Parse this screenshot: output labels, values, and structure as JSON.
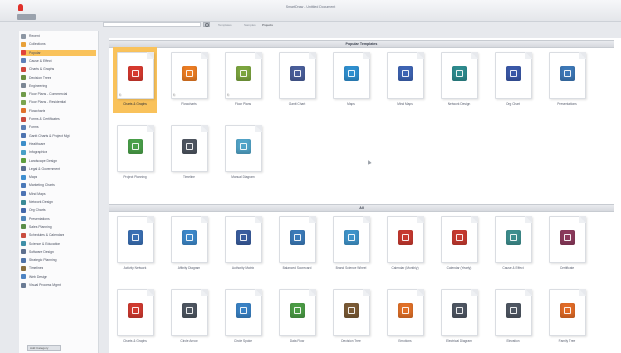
{
  "window": {
    "title": "SmartDraw - Untitled Document"
  },
  "search": {
    "placeholder": "",
    "filters": [
      "Templates",
      "Samples",
      "Projects"
    ]
  },
  "sidebar": {
    "items": [
      {
        "label": "Recent",
        "icon": "clock-icon",
        "color": "#8c96a3"
      },
      {
        "label": "Collections",
        "icon": "star-icon",
        "color": "#e8a13a"
      },
      {
        "label": "Popular",
        "icon": "heart-icon",
        "color": "#e0433b",
        "selected": true
      },
      {
        "label": "Cause & Effect",
        "icon": "fishbone-icon",
        "color": "#5d7fb8"
      },
      {
        "label": "Charts & Graphs",
        "icon": "chart-icon",
        "color": "#d0463b"
      },
      {
        "label": "Decision Trees",
        "icon": "tree-icon",
        "color": "#6b8e3f"
      },
      {
        "label": "Engineering",
        "icon": "gear-icon",
        "color": "#7b8694"
      },
      {
        "label": "Floor Plans - Commercial",
        "icon": "floorplan-icon",
        "color": "#6f9a4a"
      },
      {
        "label": "Floor Plans - Residential",
        "icon": "floorplan-icon",
        "color": "#7aa44f"
      },
      {
        "label": "Flowcharts",
        "icon": "flowchart-icon",
        "color": "#e0712c"
      },
      {
        "label": "Forms & Certificates",
        "icon": "certificate-icon",
        "color": "#c84a3f"
      },
      {
        "label": "Forms",
        "icon": "form-icon",
        "color": "#5b7fb5"
      },
      {
        "label": "Gantt Charts & Project Mgt",
        "icon": "gantt-icon",
        "color": "#4d73b0"
      },
      {
        "label": "Healthcare",
        "icon": "health-icon",
        "color": "#3d8ec9"
      },
      {
        "label": "Infographics",
        "icon": "infographic-icon",
        "color": "#48a0c7"
      },
      {
        "label": "Landscape Design",
        "icon": "landscape-icon",
        "color": "#5e9e3e"
      },
      {
        "label": "Legal & Government",
        "icon": "legal-icon",
        "color": "#5a6f92"
      },
      {
        "label": "Maps",
        "icon": "globe-icon",
        "color": "#3f8fd0"
      },
      {
        "label": "Marketing Charts",
        "icon": "marketing-icon",
        "color": "#4a78b8"
      },
      {
        "label": "Mind Maps",
        "icon": "mindmap-icon",
        "color": "#4d74b4"
      },
      {
        "label": "Network Design",
        "icon": "network-icon",
        "color": "#3a8a96"
      },
      {
        "label": "Org Charts",
        "icon": "orgchart-icon",
        "color": "#4368aa"
      },
      {
        "label": "Presentations",
        "icon": "presentation-icon",
        "color": "#4f86b9"
      },
      {
        "label": "Sales Planning",
        "icon": "sales-icon",
        "color": "#5a8e49"
      },
      {
        "label": "Schedules & Calendars",
        "icon": "calendar-icon",
        "color": "#c94d3f"
      },
      {
        "label": "Science & Education",
        "icon": "science-icon",
        "color": "#3f8fa8"
      },
      {
        "label": "Software Design",
        "icon": "software-icon",
        "color": "#5d6f8e"
      },
      {
        "label": "Strategic Planning",
        "icon": "strategy-icon",
        "color": "#4f73a8"
      },
      {
        "label": "Timelines",
        "icon": "timeline-icon",
        "color": "#8a6f3e"
      },
      {
        "label": "Web Design",
        "icon": "web-icon",
        "color": "#4d83c2"
      },
      {
        "label": "Visual Process Mgmt",
        "icon": "process-icon",
        "color": "#6a7b94"
      }
    ],
    "footer_label": "Add Category"
  },
  "sections": {
    "popular": {
      "title": "Popular Templates",
      "tiles": [
        {
          "label": "Charts & Graphs",
          "icon": "bar-chart-icon",
          "color": "#d6392f",
          "selected": true,
          "mark": "⎘"
        },
        {
          "label": "Flowcharts",
          "icon": "flowchart-icon",
          "color": "#ea7c23",
          "mark": "⎘"
        },
        {
          "label": "Floor Plans",
          "icon": "floorplan-icon",
          "color": "#7ca53f",
          "mark": "⎘"
        },
        {
          "label": "Gantt Chart",
          "icon": "gantt-icon",
          "color": "#4a5e9a"
        },
        {
          "label": "Maps",
          "icon": "globe-icon",
          "color": "#2f8fcf"
        },
        {
          "label": "Mind Maps",
          "icon": "mindmap-icon",
          "color": "#3e64b3"
        },
        {
          "label": "Network Design",
          "icon": "network-icon",
          "color": "#2e8b8e"
        },
        {
          "label": "Org Chart",
          "icon": "orgchart-icon",
          "color": "#3a58a8"
        },
        {
          "label": "Presentations",
          "icon": "presentation-icon",
          "color": "#3d78b7"
        },
        {
          "label": "Project Planning",
          "icon": "project-icon",
          "color": "#4aa049"
        },
        {
          "label": "Timeline",
          "icon": "timeline-icon",
          "color": "#4e5560"
        },
        {
          "label": "Manual Diagram",
          "icon": "diagram-icon",
          "color": "#52a4c8"
        }
      ]
    },
    "all": {
      "title": "All",
      "tiles": [
        {
          "label": "Activity Network",
          "icon": "activity-network-icon",
          "color": "#3a6fb3"
        },
        {
          "label": "Affinity Diagram",
          "icon": "affinity-icon",
          "color": "#3d88c9"
        },
        {
          "label": "Authority Matrix",
          "icon": "matrix-icon",
          "color": "#3a5d9e"
        },
        {
          "label": "Balanced Scorecard",
          "icon": "scorecard-icon",
          "color": "#3b7ab8"
        },
        {
          "label": "Brand Science Wheel",
          "icon": "wheel-icon",
          "color": "#3f93c9"
        },
        {
          "label": "Calendar (Monthly)",
          "icon": "calendar-icon",
          "color": "#c6392f"
        },
        {
          "label": "Calendar (Yearly)",
          "icon": "calendar-year-icon",
          "color": "#c63a30"
        },
        {
          "label": "Cause & Effect",
          "icon": "fishbone-icon",
          "color": "#3e8e8e"
        },
        {
          "label": "Certificate",
          "icon": "certificate-icon",
          "color": "#8c3a5c"
        },
        {
          "label": "Charts & Graphs",
          "icon": "bar-chart-icon",
          "color": "#cf3a30"
        },
        {
          "label": "Circle Arrow",
          "icon": "circle-arrow-icon",
          "color": "#4d5560"
        },
        {
          "label": "Circle Spoke",
          "icon": "circle-spoke-icon",
          "color": "#3a82c4"
        },
        {
          "label": "Data Flow",
          "icon": "dataflow-icon",
          "color": "#4b9b45"
        },
        {
          "label": "Decision Tree",
          "icon": "decision-tree-icon",
          "color": "#7a5a35"
        },
        {
          "label": "Emotions",
          "icon": "emotions-icon",
          "color": "#e07028"
        },
        {
          "label": "Electrical Diagram",
          "icon": "electrical-icon",
          "color": "#4e5662"
        },
        {
          "label": "Elevation",
          "icon": "elevation-icon",
          "color": "#4e5662"
        },
        {
          "label": "Family Tree",
          "icon": "family-tree-icon",
          "color": "#e06b27"
        }
      ]
    }
  }
}
